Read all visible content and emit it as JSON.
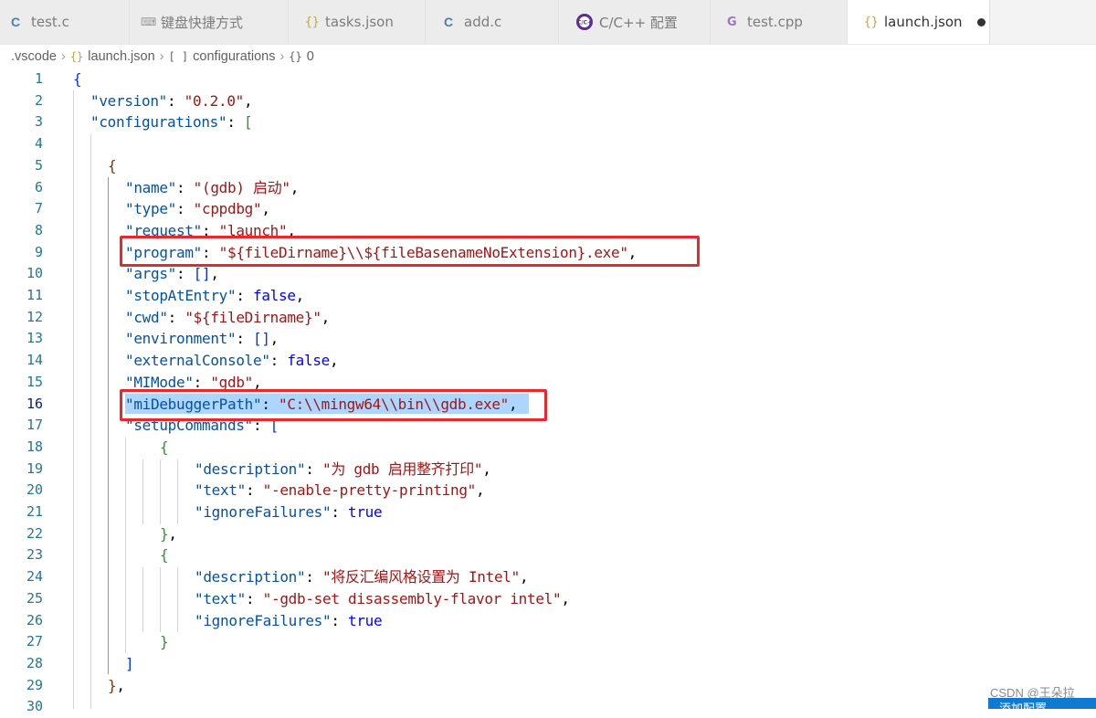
{
  "tabs": [
    {
      "label": "test.c",
      "icon": "c-file-icon",
      "glyph": "C"
    },
    {
      "label": "键盘快捷方式",
      "icon": "keyboard-icon",
      "glyph": "⌨"
    },
    {
      "label": "tasks.json",
      "icon": "json-file-icon",
      "glyph": "{}"
    },
    {
      "label": "add.c",
      "icon": "c-file-icon",
      "glyph": "C"
    },
    {
      "label": "C/C++ 配置",
      "icon": "cpp-extension-icon",
      "glyph": ""
    },
    {
      "label": "test.cpp",
      "icon": "cpp-file-icon",
      "glyph": "G"
    },
    {
      "label": "launch.json",
      "icon": "json-file-icon",
      "glyph": "{}"
    }
  ],
  "breadcrumb": {
    "folder": ".vscode",
    "file": "launch.json",
    "file_icon": "{}",
    "array": "configurations",
    "array_icon": "[ ]",
    "object": "0",
    "object_icon": "{}"
  },
  "line_numbers": [
    "1",
    "2",
    "3",
    "4",
    "5",
    "6",
    "7",
    "8",
    "9",
    "10",
    "11",
    "12",
    "13",
    "14",
    "15",
    "16",
    "17",
    "18",
    "19",
    "20",
    "21",
    "22",
    "23",
    "24",
    "25",
    "26",
    "27",
    "28",
    "29",
    "30"
  ],
  "code": {
    "l1": "{",
    "l2_key": "\"version\"",
    "l2_val": "\"0.2.0\"",
    "l3_key": "\"configurations\"",
    "l3_open": "[",
    "l5": "{",
    "l6_key": "\"name\"",
    "l6_val": "\"(gdb) 启动\"",
    "l7_key": "\"type\"",
    "l7_val": "\"cppdbg\"",
    "l8_key": "\"request\"",
    "l8_val": "\"launch\"",
    "l9_key": "\"program\"",
    "l9_val": "\"${fileDirname}\\\\${fileBasenameNoExtension}.exe\"",
    "l10_key": "\"args\"",
    "l10_val": "[]",
    "l11_key": "\"stopAtEntry\"",
    "l11_val": "false",
    "l12_key": "\"cwd\"",
    "l12_val": "\"${fileDirname}\"",
    "l13_key": "\"environment\"",
    "l13_val": "[]",
    "l14_key": "\"externalConsole\"",
    "l14_val": "false",
    "l15_key": "\"MIMode\"",
    "l15_val": "\"gdb\"",
    "l16_key": "\"miDebuggerPath\"",
    "l16_val": "\"C:\\\\mingw64\\\\bin\\\\gdb.exe\"",
    "l17_key": "\"setupCommands\"",
    "l17_open": "[",
    "l18": "{",
    "l19_key": "\"description\"",
    "l19_val": "\"为 gdb 启用整齐打印\"",
    "l20_key": "\"text\"",
    "l20_val": "\"-enable-pretty-printing\"",
    "l21_key": "\"ignoreFailures\"",
    "l21_val": "true",
    "l22": "}",
    "l23": "{",
    "l24_key": "\"description\"",
    "l24_val": "\"将反汇编风格设置为 Intel\"",
    "l25_key": "\"text\"",
    "l25_val": "\"-gdb-set disassembly-flavor intel\"",
    "l26_key": "\"ignoreFailures\"",
    "l26_val": "true",
    "l27": "}",
    "l28": "]",
    "l29": "}"
  },
  "watermark": "CSDN @王朵拉",
  "notification": "添加配置...",
  "colors": {
    "highlight_box": "#e8282c",
    "selection": "#add6ff",
    "json_key": "#0451a5",
    "json_string": "#a31515",
    "json_keyword": "#0000ff"
  }
}
